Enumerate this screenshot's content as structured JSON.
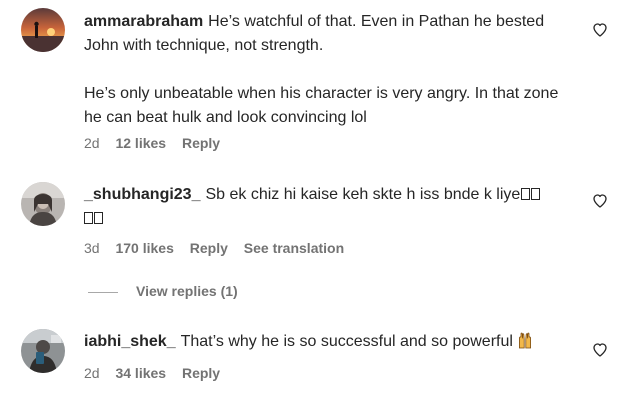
{
  "comments": [
    {
      "username": "ammarabraham",
      "text_para1": "He’s watchful of that. Even in Pathan he bested John with technique, not strength.",
      "text_para2": "He’s only unbeatable when his character is very angry. In that zone he can beat hulk and look convincing lol",
      "time": "2d",
      "likes": "12 likes",
      "reply": "Reply"
    },
    {
      "username": "_shubhangi23_",
      "text": "Sb ek chiz hi kaise keh skte h iss bnde k liye",
      "time": "3d",
      "likes": "170 likes",
      "reply": "Reply",
      "translate": "See translation",
      "view_replies": "View replies (1)"
    },
    {
      "username": "iabhi_shek_",
      "text": "That’s why he is so successful and so powerful",
      "emoji": "raising-hands-emoji",
      "time": "2d",
      "likes": "34 likes",
      "reply": "Reply"
    }
  ],
  "icons": {
    "like": "heart-outline-icon"
  },
  "colors": {
    "text": "#262626",
    "secondary": "#737373"
  }
}
